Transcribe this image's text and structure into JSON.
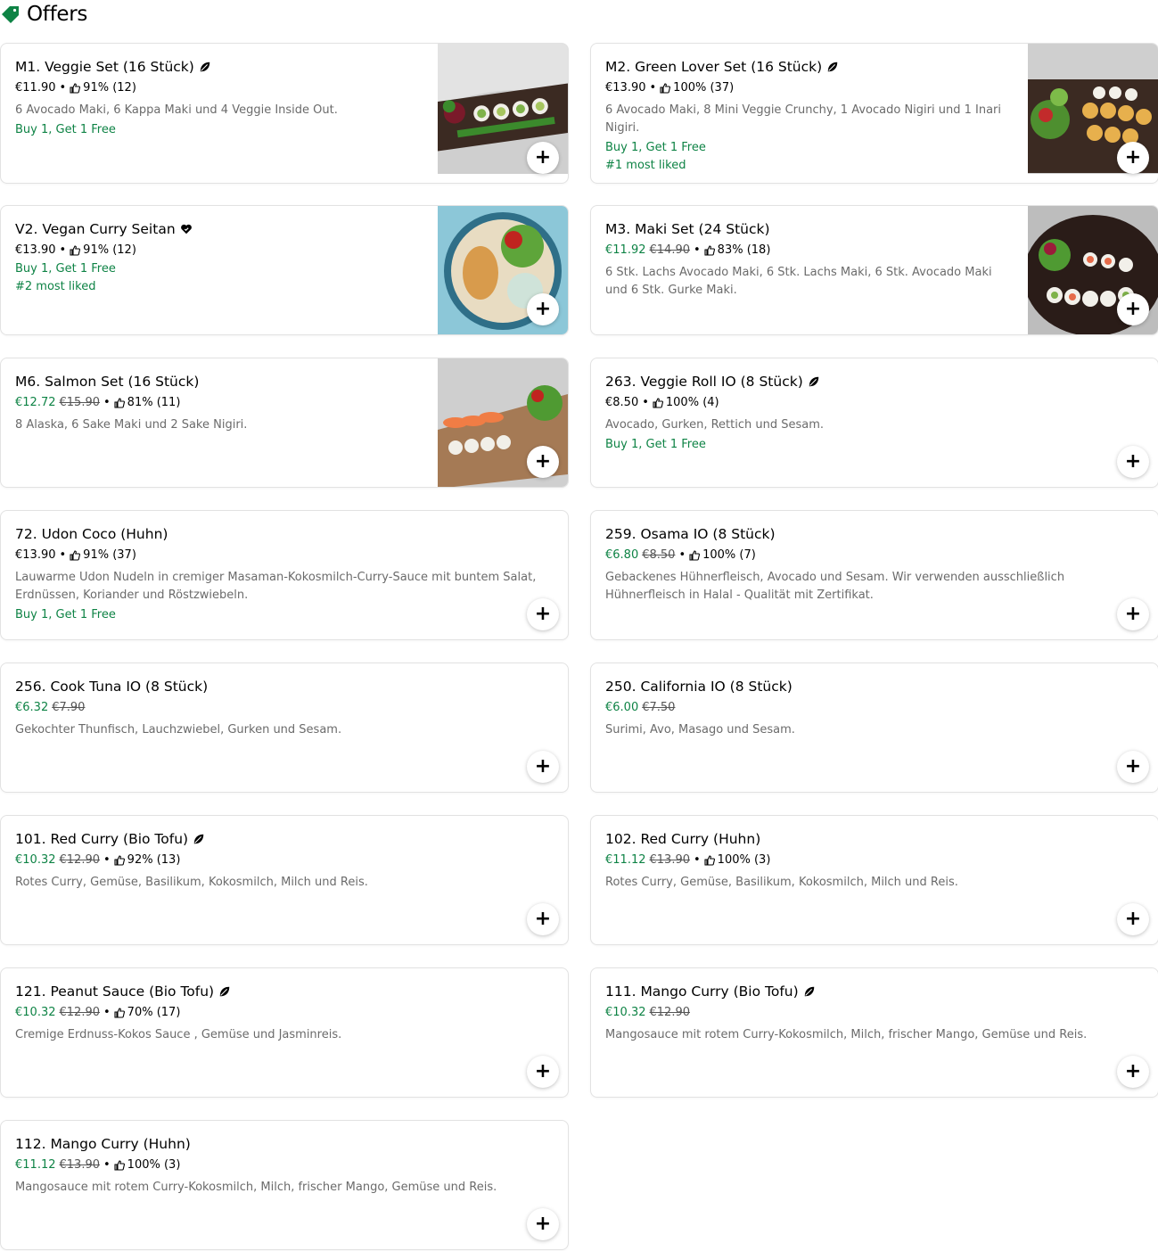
{
  "section": {
    "title": "Offers"
  },
  "cards": [
    {
      "title": "M1. Veggie Set (16 Stück)",
      "price": "€11.90",
      "old": "",
      "rating": "91% (12)",
      "desc": "6 Avocado Maki, 6 Kappa Maki und 4 Veggie Inside Out.",
      "promos": [
        "Buy 1, Get 1 Free"
      ],
      "diet": "leaf-icon",
      "image": "sushi-platter-veggie"
    },
    {
      "title": "M2. Green Lover Set (16 Stück)",
      "price": "€13.90",
      "old": "",
      "rating": "100% (37)",
      "desc": "6 Avocado Maki, 8 Mini Veggie Crunchy, 1 Avocado Nigiri und 1 Inari Nigiri.",
      "promos": [
        "Buy 1, Get 1 Free",
        "#1 most liked"
      ],
      "diet": "leaf-icon",
      "image": "sushi-platter-green"
    },
    {
      "title": "V2. Vegan Curry Seitan",
      "price": "€13.90",
      "old": "",
      "rating": "91% (12)",
      "desc": "",
      "promos": [
        "Buy 1, Get 1 Free",
        "#2 most liked"
      ],
      "diet": "heart-icon",
      "image": "curry-bowl"
    },
    {
      "title": "M3. Maki Set (24 Stück)",
      "price": "€11.92",
      "old": "€14.90",
      "rating": "83% (18)",
      "desc": "6 Stk. Lachs Avocado Maki, 6 Stk. Lachs Maki, 6 Stk. Avocado Maki und 6 Stk. Gurke Maki.",
      "promos": [],
      "diet": "",
      "image": "maki-plate"
    },
    {
      "title": "M6. Salmon Set (16 Stück)",
      "price": "€12.72",
      "old": "€15.90",
      "rating": "81% (11)",
      "desc": "8 Alaska, 6 Sake Maki und 2 Sake Nigiri.",
      "promos": [],
      "diet": "",
      "image": "salmon-board"
    },
    {
      "title": "263. Veggie Roll IO (8 Stück)",
      "price": "€8.50",
      "old": "",
      "rating": "100% (4)",
      "desc": "Avocado, Gurken, Rettich und Sesam.",
      "promos": [
        "Buy 1, Get 1 Free"
      ],
      "diet": "leaf-icon",
      "image": ""
    },
    {
      "title": "72. Udon Coco (Huhn)",
      "price": "€13.90",
      "old": "",
      "rating": "91% (37)",
      "desc": "Lauwarme Udon Nudeln in cremiger Masaman-Kokosmilch-Curry-Sauce mit buntem Salat, Erdnüssen, Koriander und Röstzwiebeln.",
      "promos": [
        "Buy 1, Get 1 Free"
      ],
      "diet": "",
      "image": ""
    },
    {
      "title": "259. Osama IO (8 Stück)",
      "price": "€6.80",
      "old": "€8.50",
      "rating": "100% (7)",
      "desc": "Gebackenes Hühnerfleisch, Avocado und Sesam. Wir verwenden ausschließlich Hühnerfleisch in Halal - Qualität mit Zertifikat.",
      "promos": [],
      "diet": "",
      "image": ""
    },
    {
      "title": "256. Cook Tuna IO (8 Stück)",
      "price": "€6.32",
      "old": "€7.90",
      "rating": "",
      "desc": "Gekochter Thunfisch, Lauchzwiebel, Gurken und Sesam.",
      "promos": [],
      "diet": "",
      "image": ""
    },
    {
      "title": "250. California IO (8 Stück)",
      "price": "€6.00",
      "old": "€7.50",
      "rating": "",
      "desc": "Surimi, Avo, Masago und Sesam.",
      "promos": [],
      "diet": "",
      "image": ""
    },
    {
      "title": "101. Red Curry (Bio Tofu)",
      "price": "€10.32",
      "old": "€12.90",
      "rating": "92% (13)",
      "desc": "Rotes Curry, Gemüse, Basilikum, Kokosmilch, Milch und Reis.",
      "promos": [],
      "diet": "leaf-icon",
      "image": ""
    },
    {
      "title": "102. Red Curry (Huhn)",
      "price": "€11.12",
      "old": "€13.90",
      "rating": "100% (3)",
      "desc": "Rotes Curry, Gemüse, Basilikum, Kokosmilch, Milch und Reis.",
      "promos": [],
      "diet": "",
      "image": ""
    },
    {
      "title": "121. Peanut Sauce (Bio Tofu)",
      "price": "€10.32",
      "old": "€12.90",
      "rating": "70% (17)",
      "desc": "Cremige Erdnuss-Kokos Sauce , Gemüse und Jasminreis.",
      "promos": [],
      "diet": "leaf-icon",
      "image": ""
    },
    {
      "title": "111. Mango Curry (Bio Tofu)",
      "price": "€10.32",
      "old": "€12.90",
      "rating": "",
      "desc": "Mangosauce mit rotem Curry-Kokosmilch, Milch, frischer Mango, Gemüse und Reis.",
      "promos": [],
      "diet": "leaf-icon",
      "image": ""
    },
    {
      "title": "112. Mango Curry (Huhn)",
      "price": "€11.12",
      "old": "€13.90",
      "rating": "100% (3)",
      "desc": "Mangosauce mit rotem Curry-Kokosmilch, Milch, frischer Mango, Gemüse und Reis.",
      "promos": [],
      "diet": "",
      "image": ""
    }
  ],
  "add_label": "+",
  "colors": {
    "accent": "#0e8345",
    "border": "#e2e2e2",
    "muted": "#6b6b6b"
  }
}
